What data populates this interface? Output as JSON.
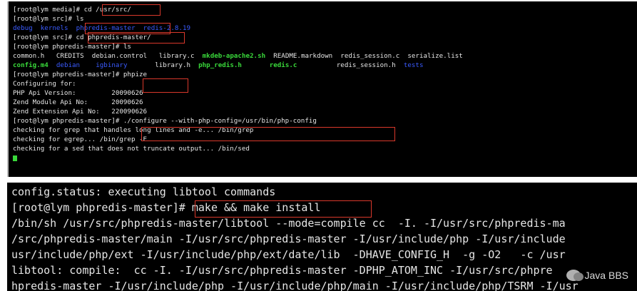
{
  "top_terminal": {
    "lines": [
      "[root@lym media]# cd /usr/src/",
      "[root@lym src]# ls",
      [
        "debug",
        "kernels",
        "phpredis-master",
        "redis-2.8.19"
      ],
      "[root@lym src]# cd phpredis-master/",
      "[root@lym phpredis-master]# ls",
      [
        "common.h",
        "CREDITS",
        "debian.control",
        "library.c",
        "mkdeb-apache2.sh",
        "README.markdown",
        "redis_session.c",
        "serialize.list"
      ],
      [
        "config.m4",
        "debian",
        "igbinary",
        "library.h",
        "php_redis.h",
        "redis.c",
        "redis_session.h",
        "tests"
      ],
      "[root@lym phpredis-master]# phpize",
      "Configuring for:",
      "PHP Api Version:         20090626",
      "Zend Module Api No:      20090626",
      "Zend Extension Api No:   220090626",
      "[root@lym phpredis-master]# ./configure --with-php-config=/usr/bin/php-config",
      "checking for grep that handles long lines and -e... /bin/grep",
      "checking for egrep... /bin/grep -E",
      "checking for a sed that does not truncate output... /bin/sed"
    ]
  },
  "bottom_terminal": {
    "lines": [
      "config.status: executing libtool commands",
      "[root@lym phpredis-master]# make && make install",
      "/bin/sh /usr/src/phpredis-master/libtool --mode=compile cc  -I. -I/usr/src/phpredis-ma",
      "/src/phpredis-master/main -I/usr/src/phpredis-master -I/usr/include/php -I/usr/include",
      "usr/include/php/ext -I/usr/include/php/ext/date/lib  -DHAVE_CONFIG_H  -g -O2   -c /usr",
      "libtool: compile:  cc -I. -I/usr/src/phpredis-master -DPHP_ATOM_INC -I/usr/src/phpre",
      "hpredis-master -I/usr/include/php -I/usr/include/php/main -I/usr/include/php/TSRM -I/usr"
    ]
  },
  "watermark": {
    "text": "Java BBS",
    "icon": "wechat-icon"
  },
  "colors": {
    "directory": "#3a5bff",
    "executable": "#39d83a",
    "highlight_box": "#d9382b"
  }
}
